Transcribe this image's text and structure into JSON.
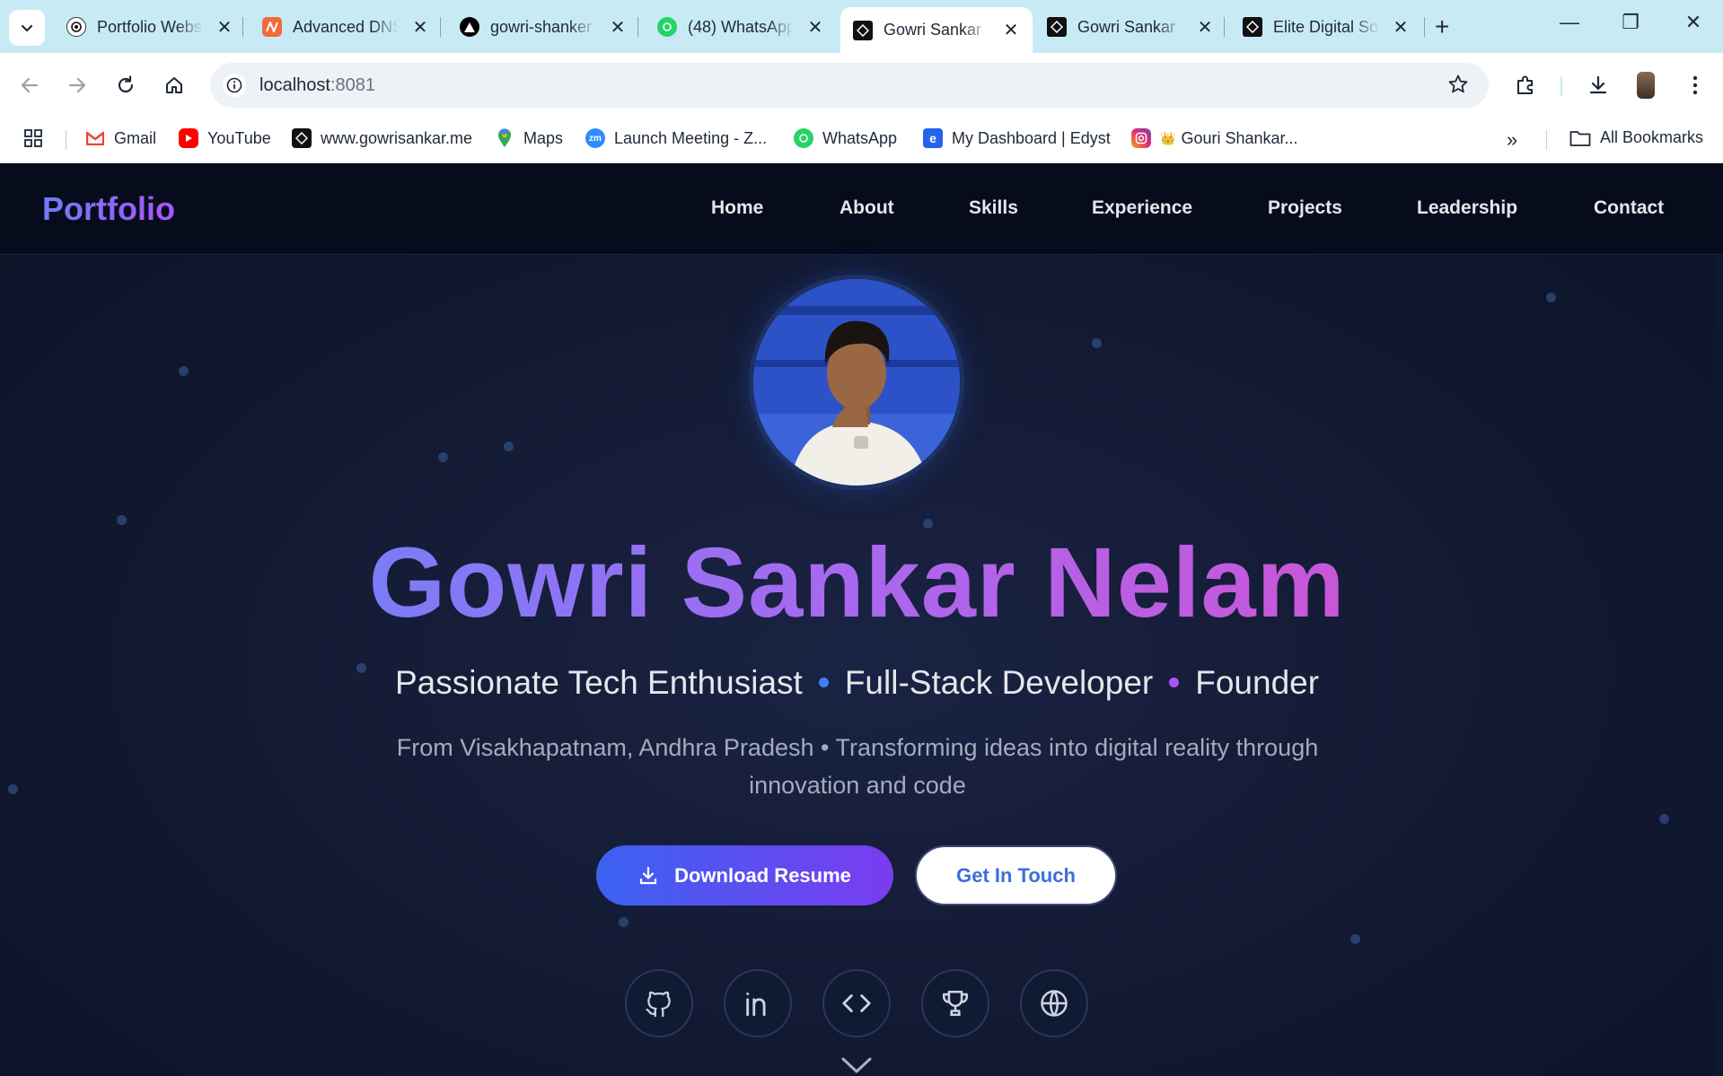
{
  "browser": {
    "tabs": [
      {
        "title": "Portfolio Website",
        "active": false
      },
      {
        "title": "Advanced DNS",
        "active": false
      },
      {
        "title": "gowri-shanker",
        "active": false
      },
      {
        "title": "(48) WhatsApp",
        "active": false
      },
      {
        "title": "Gowri Sankar",
        "active": true
      },
      {
        "title": "Gowri Sankar",
        "active": false
      },
      {
        "title": "Elite Digital Solutions",
        "active": false
      }
    ],
    "url_host": "localhost",
    "url_port": ":8081",
    "bookmarks": [
      {
        "label": "Gmail",
        "icon": "gmail-icon"
      },
      {
        "label": "YouTube",
        "icon": "youtube-icon"
      },
      {
        "label": "www.gowrisankar.me",
        "icon": "site-icon"
      },
      {
        "label": "Maps",
        "icon": "maps-icon"
      },
      {
        "label": "Launch Meeting - Z...",
        "icon": "zoom-icon"
      },
      {
        "label": "WhatsApp",
        "icon": "whatsapp-icon"
      },
      {
        "label": "My Dashboard | Edyst",
        "icon": "edyst-icon"
      },
      {
        "label": "Gouri Shankar...",
        "icon": "instagram-icon"
      }
    ],
    "all_bookmarks": "All Bookmarks",
    "colors": {
      "tabstrip": "#c8eaf4",
      "omnibox": "#eef1f5"
    }
  },
  "site": {
    "logo": "Portfolio",
    "nav": [
      "Home",
      "About",
      "Skills",
      "Experience",
      "Projects",
      "Leadership",
      "Contact"
    ],
    "hero": {
      "name": "Gowri Sankar Nelam",
      "roles": [
        "Passionate Tech Enthusiast",
        "Full-Stack Developer",
        "Founder"
      ],
      "description": "From Visakhapatnam, Andhra Pradesh • Transforming ideas into digital reality through innovation and code",
      "primary_button": "Download Resume",
      "secondary_button": "Get In Touch"
    },
    "social_icons": [
      "github-icon",
      "linkedin-icon",
      "code-icon",
      "trophy-icon",
      "globe-icon"
    ],
    "colors": {
      "accent_blue": "#3b82f6",
      "accent_purple": "#a855f7",
      "background": "#0b1226"
    }
  }
}
